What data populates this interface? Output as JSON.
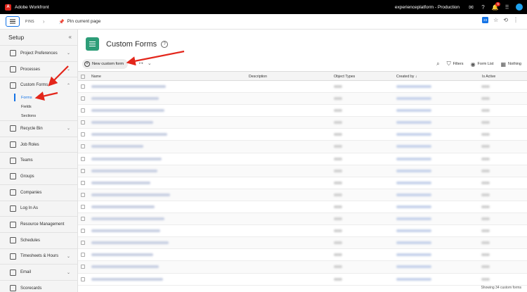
{
  "topbar": {
    "app_name": "Adobe Workfront",
    "environment": "experienceplatform - Production",
    "notification_count": "5"
  },
  "subbar": {
    "pins_label": "PINS",
    "pin_current_page": "Pin current page",
    "calendar_day": "23"
  },
  "sidebar": {
    "title": "Setup",
    "items": [
      {
        "label": "Project Preferences",
        "caret": "⌄"
      },
      {
        "label": "Processes",
        "caret": "⌄"
      },
      {
        "label": "Custom Forms",
        "caret": "⌃"
      },
      {
        "label": "Recycle Bin",
        "caret": "⌄"
      },
      {
        "label": "Job Roles",
        "caret": ""
      },
      {
        "label": "Teams",
        "caret": ""
      },
      {
        "label": "Groups",
        "caret": ""
      },
      {
        "label": "Companies",
        "caret": ""
      },
      {
        "label": "Log In As",
        "caret": ""
      },
      {
        "label": "Resource Management",
        "caret": ""
      },
      {
        "label": "Schedules",
        "caret": ""
      },
      {
        "label": "Timesheets & Hours",
        "caret": "⌄"
      },
      {
        "label": "Email",
        "caret": "⌄"
      },
      {
        "label": "Scorecards",
        "caret": ""
      }
    ],
    "custom_forms_children": [
      "Forms",
      "Fields",
      "Sections"
    ]
  },
  "page": {
    "title": "Custom Forms",
    "help": "?"
  },
  "toolbar": {
    "new_button": "New custom form",
    "filters": "Filters",
    "form_list": "Form List",
    "nothing": "Nothing"
  },
  "table": {
    "columns": [
      "Name",
      "Description",
      "Object Types",
      "Created by ↓",
      "Is Active"
    ]
  },
  "footer": {
    "count_text": "Showing 34 custom forms"
  },
  "colors": {
    "accent": "#1473e6",
    "brand_red": "#e1251b",
    "forms_icon": "#2d9d78",
    "annotation": "#e3261b"
  }
}
